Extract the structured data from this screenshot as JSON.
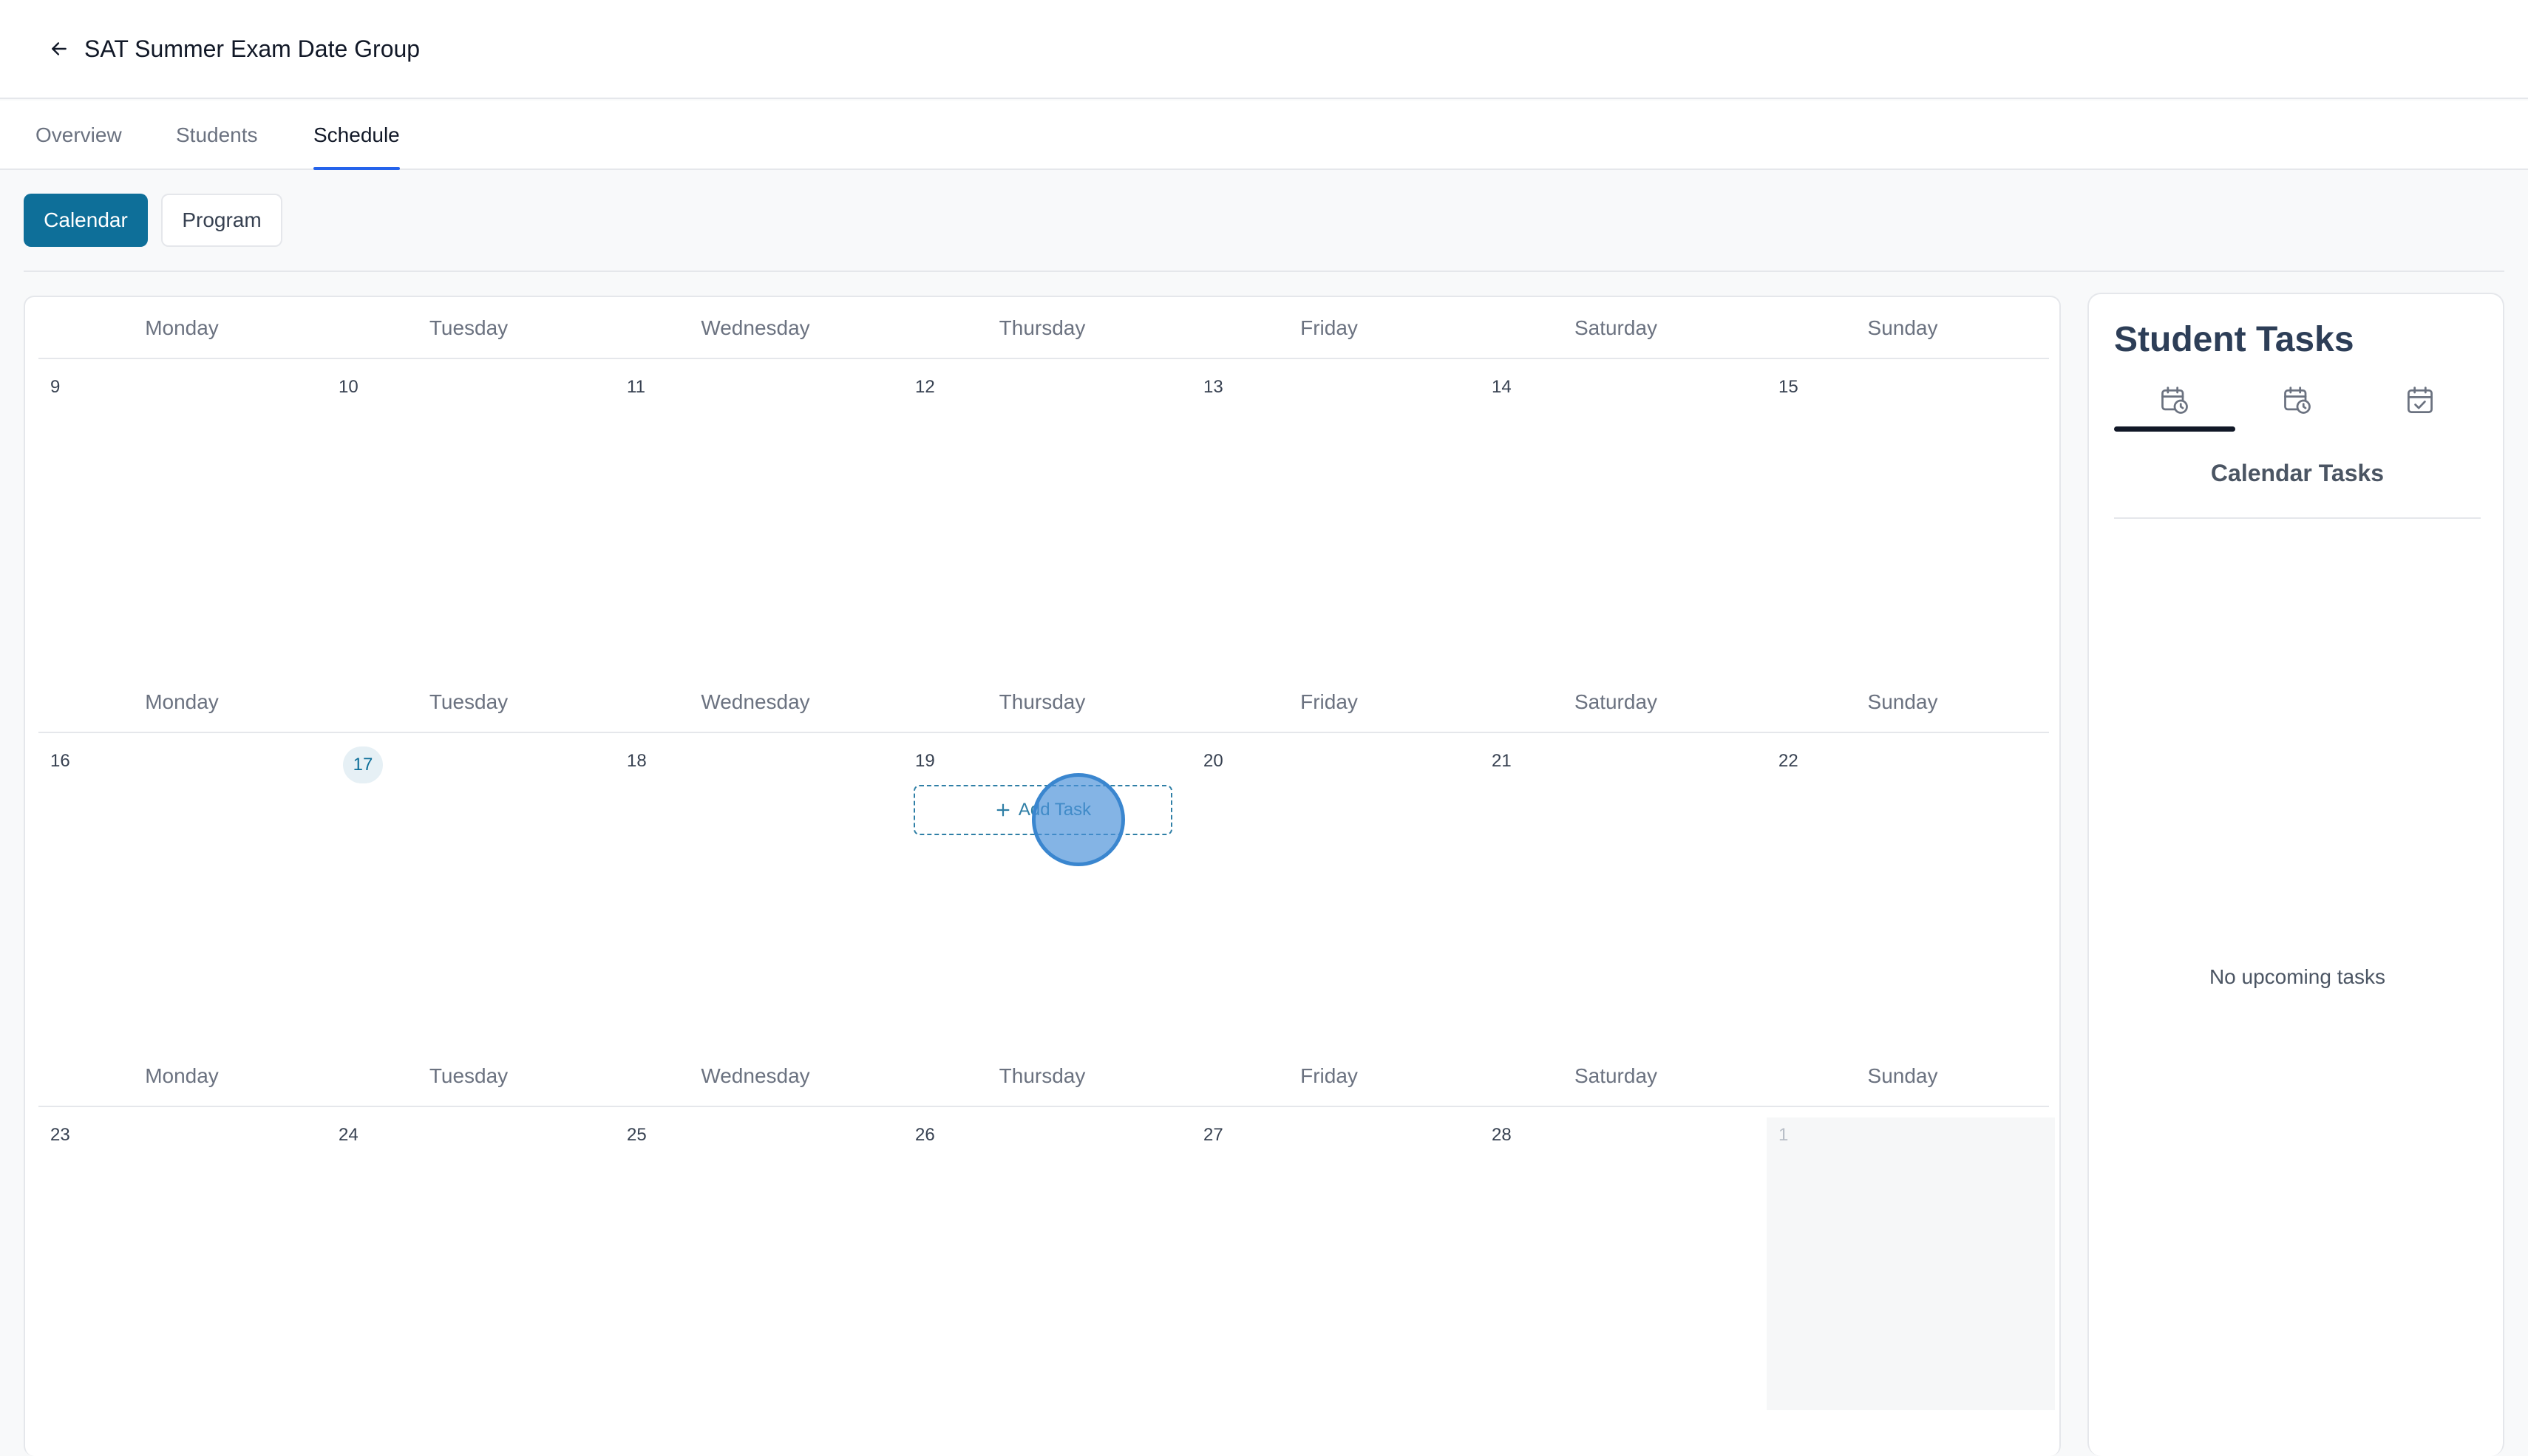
{
  "header": {
    "title": "SAT Summer Exam Date Group"
  },
  "tabs": [
    {
      "label": "Overview",
      "active": false
    },
    {
      "label": "Students",
      "active": false
    },
    {
      "label": "Schedule",
      "active": true
    }
  ],
  "view_toggle": {
    "calendar_label": "Calendar",
    "program_label": "Program",
    "selected": "Calendar"
  },
  "calendar": {
    "day_names": [
      "Monday",
      "Tuesday",
      "Wednesday",
      "Thursday",
      "Friday",
      "Saturday",
      "Sunday"
    ],
    "today": "17",
    "add_task_label": "Add Task",
    "weeks": [
      {
        "days": [
          "9",
          "10",
          "11",
          "12",
          "13",
          "14",
          "15"
        ]
      },
      {
        "days": [
          "16",
          "17",
          "18",
          "19",
          "20",
          "21",
          "22"
        ]
      },
      {
        "days": [
          "23",
          "24",
          "25",
          "26",
          "27",
          "28",
          "1"
        ]
      }
    ]
  },
  "tasks_panel": {
    "title": "Student Tasks",
    "subtitle": "Calendar Tasks",
    "empty_message": "No upcoming tasks",
    "tab_icons": [
      "calendar-clock-icon",
      "calendar-clock-icon",
      "calendar-check-icon"
    ],
    "active_tab": 0
  },
  "colors": {
    "primary": "#0e6f99",
    "tab_underline": "#2563eb",
    "title": "#2d3e57"
  }
}
